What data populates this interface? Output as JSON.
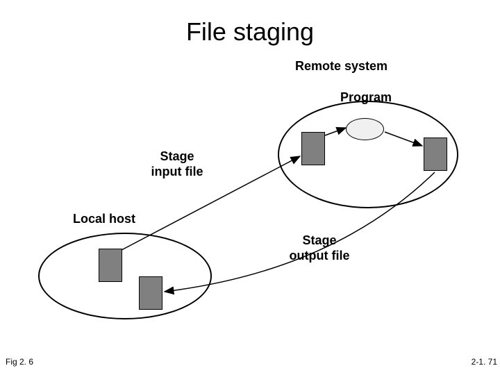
{
  "title": "File staging",
  "labels": {
    "remote_system": "Remote system",
    "program": "Program",
    "stage_input": "Stage\ninput file",
    "local_host": "Local host",
    "stage_output": "Stage\noutput file"
  },
  "footer": {
    "left": "Fig 2. 6",
    "right": "2-1. 71"
  }
}
